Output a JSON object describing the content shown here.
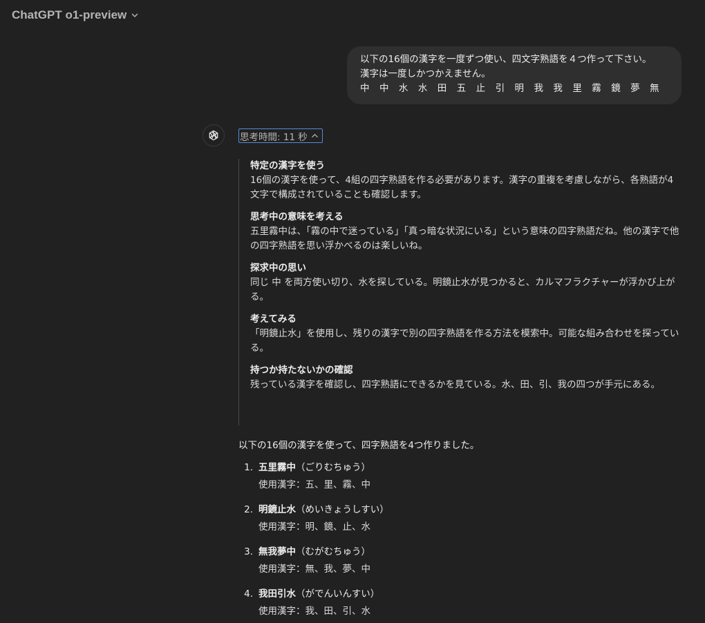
{
  "header": {
    "model_name": "ChatGPT o1-preview"
  },
  "user_message": {
    "line1": "以下の16個の漢字を一度ずつ使い、四文字熟語を４つ作って下さい。",
    "line2": "漢字は一度しかつかえません。",
    "kanji": [
      "中",
      "中",
      "水",
      "水",
      "田",
      "五",
      "止",
      "引",
      "明",
      "我",
      "我",
      "里",
      "霧",
      "鏡",
      "夢",
      "無"
    ]
  },
  "assistant": {
    "thinking_toggle_label": "思考時間: 11 秒",
    "thoughts": [
      {
        "title": "特定の漢字を使う",
        "body": "16個の漢字を使って、4組の四字熟語を作る必要があります。漢字の重複を考慮しながら、各熟語が4文字で構成されていることも確認します。"
      },
      {
        "title": "思考中の意味を考える",
        "body": "五里霧中は、「霧の中で迷っている」「真っ暗な状況にいる」という意味の四字熟語だね。他の漢字で他の四字熟語を思い浮かべるのは楽しいね。"
      },
      {
        "title": "探求中の思い",
        "body": "同じ 中 を両方使い切り、水を探している。明鏡止水が見つかると、カルマフラクチャーが浮かび上がる。"
      },
      {
        "title": "考えてみる",
        "body": "「明鏡止水」を使用し、残りの漢字で別の四字熟語を作る方法を模索中。可能な組み合わせを探っている。"
      },
      {
        "title": "持つか持たないかの確認",
        "body": "残っている漢字を確認し、四字熟語にできるかを見ている。水、田、引、我の四つが手元にある。"
      }
    ],
    "answer_intro": "以下の16個の漢字を使って、四字熟語を4つ作りました。",
    "answers": [
      {
        "number": "1.",
        "term": "五里霧中",
        "reading": "（ごりむちゅう）",
        "used": "使用漢字：五、里、霧、中"
      },
      {
        "number": "2.",
        "term": "明鏡止水",
        "reading": "（めいきょうしすい）",
        "used": "使用漢字：明、鏡、止、水"
      },
      {
        "number": "3.",
        "term": "無我夢中",
        "reading": "（むがむちゅう）",
        "used": "使用漢字：無、我、夢、中"
      },
      {
        "number": "4.",
        "term": "我田引水",
        "reading": "（がでんいんすい）",
        "used": "使用漢字：我、田、引、水"
      }
    ]
  },
  "icons": {
    "model_chevron": "chevron-down-icon",
    "avatar": "openai-logo-icon",
    "thinking_chevron": "chevron-up-icon"
  },
  "colors": {
    "background": "#212121",
    "bubble": "#2f2f2f",
    "focus_outline": "#5b8ad6"
  }
}
